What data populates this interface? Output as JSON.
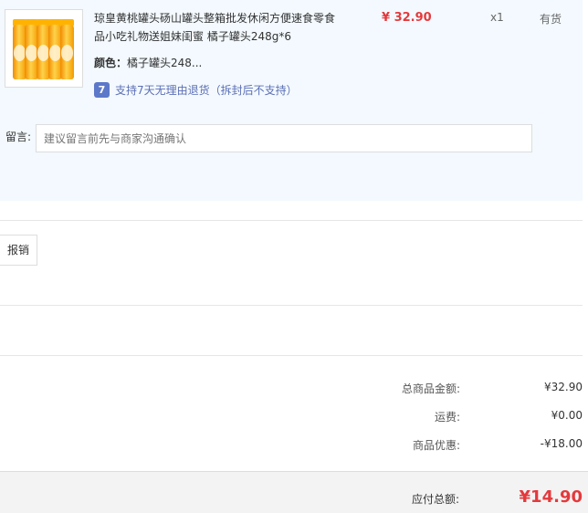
{
  "product": {
    "title": "琼皇黄桃罐头砀山罐头整箱批发休闲方便速食零食品小吃礼物送姐妹闺蜜 橘子罐头248g*6",
    "price": "¥ 32.90",
    "quantity": "x1",
    "stock": "有货",
    "color_label": "颜色：",
    "color_value": "橘子罐头248...",
    "return_icon": "7",
    "return_text": "支持7天无理由退货（拆封后不支持）"
  },
  "message": {
    "label": "留言:",
    "placeholder": "建议留言前先与商家沟通确认"
  },
  "reimbursement": {
    "button_label": "报销"
  },
  "summary": {
    "goods_total_label": "总商品金额:",
    "goods_total_value": "¥32.90",
    "shipping_label": "运费:",
    "shipping_value": "¥0.00",
    "discount_label": "商品优惠:",
    "discount_value": "-¥18.00"
  },
  "total": {
    "label": "应付总额:",
    "value": "¥14.90"
  },
  "colors": {
    "accent_red": "#e4393c",
    "order_bg": "#f3f9fe",
    "return_blue": "#5c79c9"
  }
}
